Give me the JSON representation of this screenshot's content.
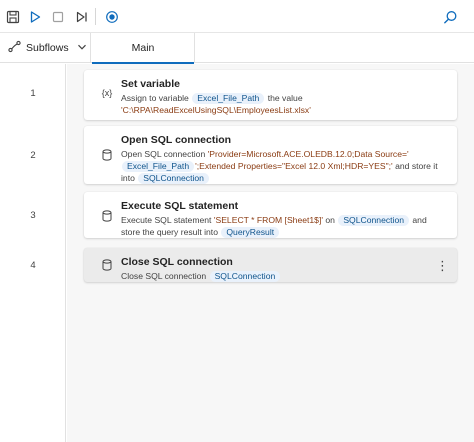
{
  "toolbar": {
    "buttons": [
      "save-icon",
      "run-icon",
      "stop-icon",
      "run-next-action-icon",
      "record-icon"
    ],
    "search": "search-icon"
  },
  "tabs": {
    "subflows_label": "Subflows",
    "main_label": "Main"
  },
  "actions": [
    {
      "line": "1",
      "icon": "{x}",
      "title": "Set variable",
      "desc": {
        "p1": "Assign to variable ",
        "v1": "Excel_File_Path",
        "p2": " the value ",
        "l1": "'C:\\RPA\\ReadExcelUsingSQL\\EmployeesList.xlsx'"
      }
    },
    {
      "line": "2",
      "icon": "database-icon",
      "title": "Open SQL connection",
      "desc": {
        "p1": "Open SQL connection ",
        "l1": "'Provider=Microsoft.ACE.OLEDB.12.0;Data Source='",
        "v1": "Excel_File_Path",
        "l2": "';Extended Properties=\"Excel 12.0 Xml;HDR=YES\";'",
        "p2": " and store it into ",
        "v2": "SQLConnection"
      }
    },
    {
      "line": "3",
      "icon": "database-icon",
      "title": "Execute SQL statement",
      "desc": {
        "p1": "Execute SQL statement ",
        "l1": "'SELECT * FROM [Sheet1$]'",
        "p2": " on ",
        "v1": "SQLConnection",
        "p3": " and store the query result into ",
        "v2": "QueryResult"
      }
    },
    {
      "line": "4",
      "icon": "database-icon",
      "title": "Close SQL connection",
      "desc": {
        "p1": "Close SQL connection ",
        "v1": "SQLConnection"
      },
      "more": "⋮"
    }
  ],
  "colors": {
    "accent": "#0f6cbd",
    "token_bg": "#e9f1fb",
    "token_text": "#0f548c",
    "literal_text": "#8a3b12",
    "selected_bg": "#ebebeb"
  }
}
